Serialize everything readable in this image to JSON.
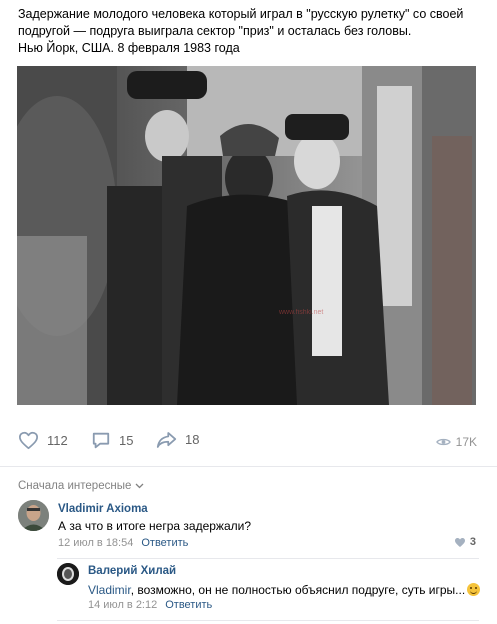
{
  "post": {
    "text_lines": [
      "Задержание молодого человека который играл в \"русскую рулетку\" со своей",
      "подругой — подруга выиграла сектор \"приз\" и осталась без головы.",
      "Нью Йорк, США. 8 февраля 1983 года"
    ],
    "photo": {
      "watermark": "www.fishki.net"
    }
  },
  "actions": {
    "likes": "112",
    "comments": "15",
    "shares": "18",
    "views": "17K"
  },
  "comments_header": {
    "sort_label": "Сначала интересные"
  },
  "comments": [
    {
      "author": "Vladimir Axioma",
      "text": "А за что в итоге негра задержали?",
      "date": "12 июл в 18:54",
      "reply_label": "Ответить",
      "likes": "3"
    },
    {
      "author": "Валерий Хилай",
      "mention": "Vladimir",
      "text": ", возможно, он не полностью объяснил подруге, суть игры...",
      "date": "14 июл в 2:12",
      "reply_label": "Ответить"
    }
  ],
  "colors": {
    "link": "#2a5885",
    "muted": "#939393",
    "separator": "#e7e8ec"
  }
}
